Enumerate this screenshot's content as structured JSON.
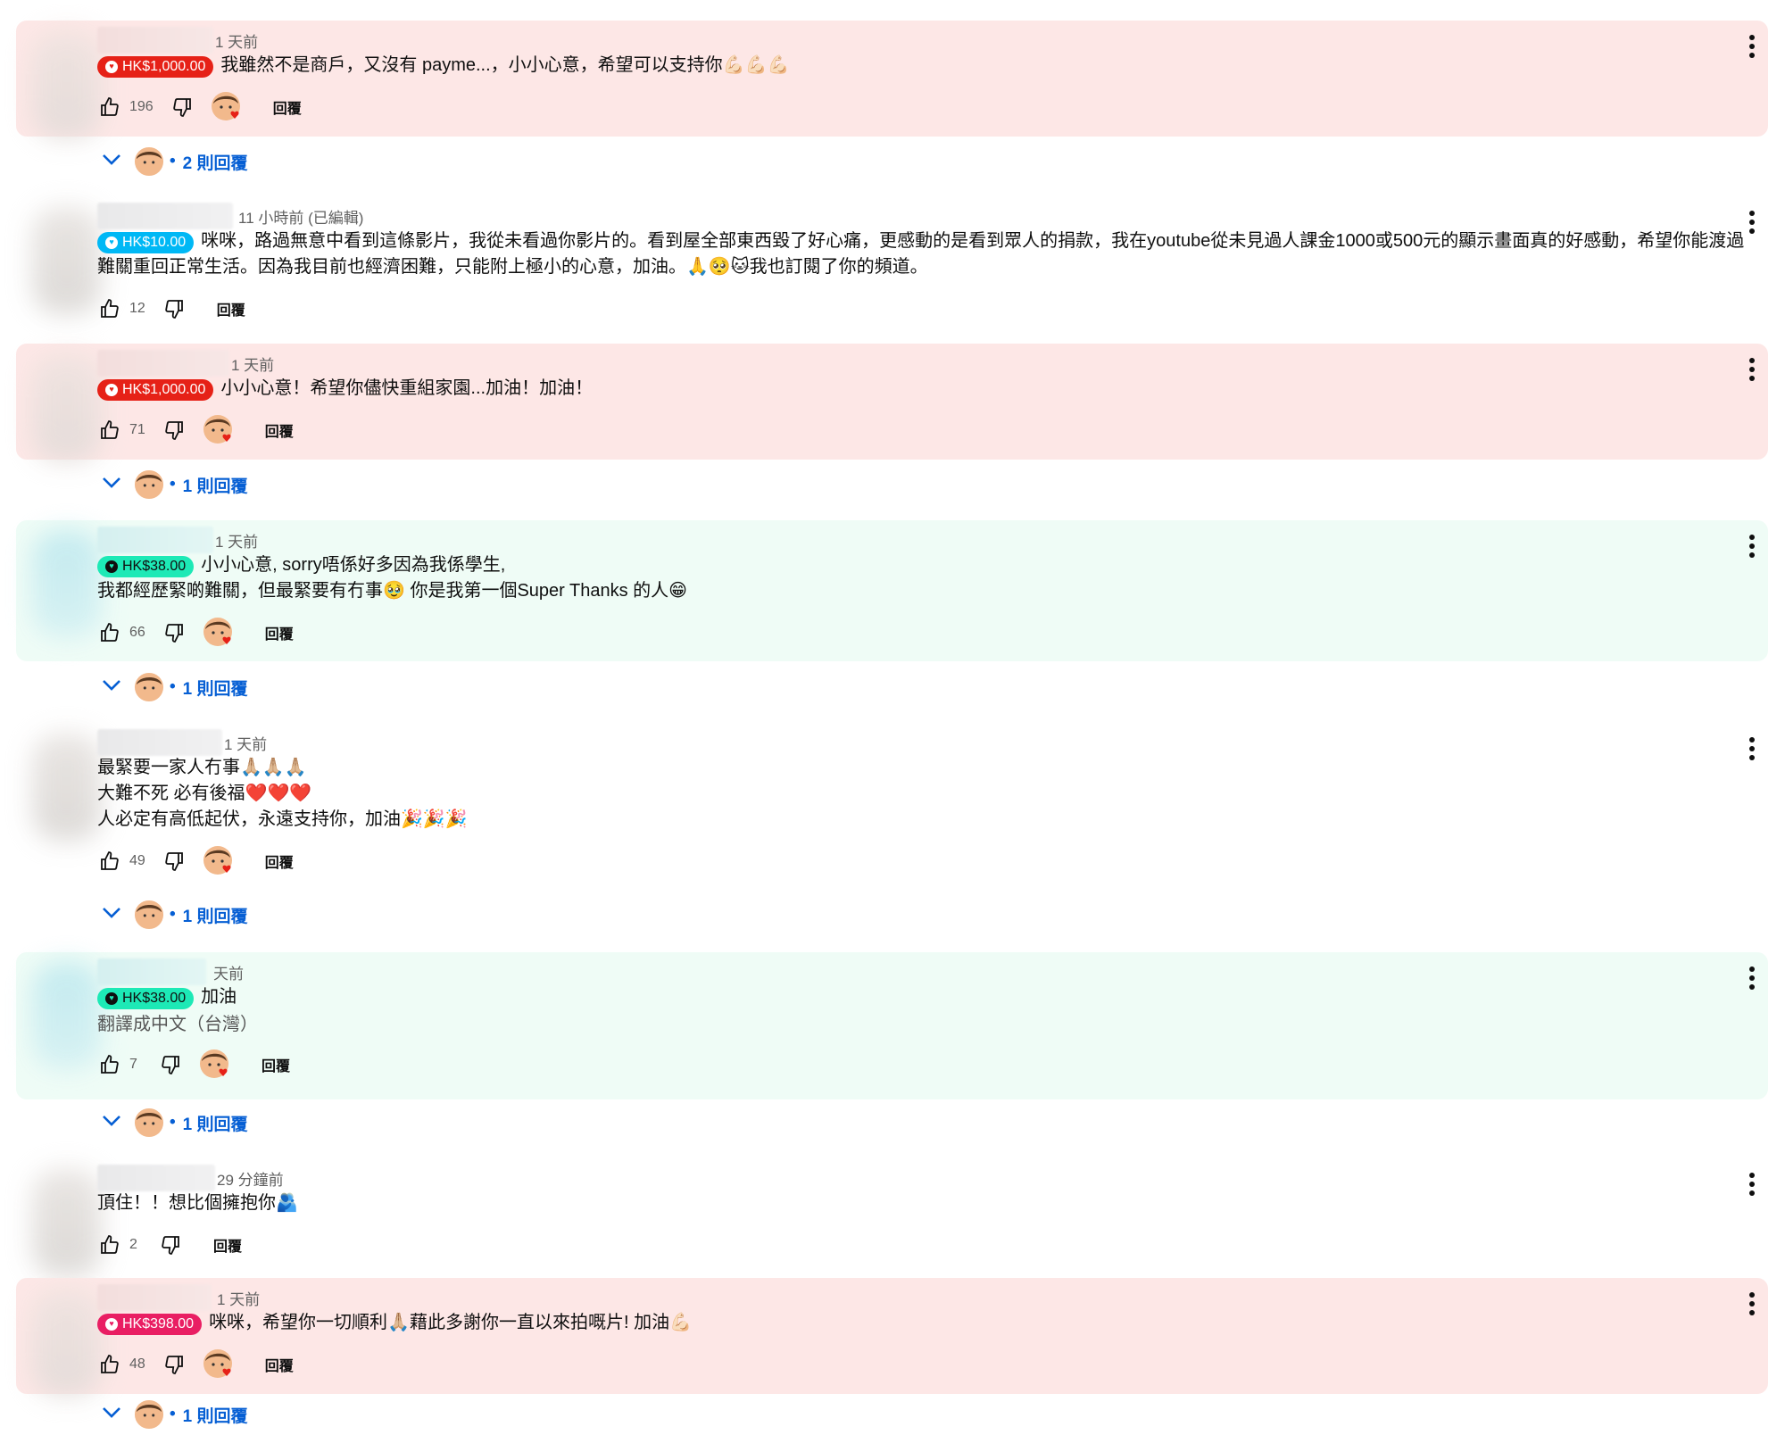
{
  "labels": {
    "reply": "回覆"
  },
  "colors": {
    "red_badge": "#e62117",
    "blue_badge": "#00b8f5",
    "green_badge": "#1de9b6",
    "magenta_badge": "#e91e63",
    "link": "#065fd4"
  },
  "comments": [
    {
      "time": "1 天前",
      "amount": "HK$1,000.00",
      "badge_color": "#e62117",
      "lines": [
        "我雖然不是商戶，又沒有 payme...，小小心意，希望可以支持你💪🏻💪🏻💪🏻"
      ],
      "translation": "",
      "likes": "196",
      "replies": "2 則回覆"
    },
    {
      "time": "11 小時前 (已編輯)",
      "amount": "HK$10.00",
      "badge_color": "#00b8f5",
      "lines": [
        "咪咪，路過無意中看到這條影片，我從未看過你影片的。看到屋全部東西毀了好心痛，更感動的是看到眾人的捐款，我在youtube從未見過人課金1000或500元的顯示畫面真的好感動，希望你能渡過",
        "難關重回正常生活。因為我目前也經濟困難，只能附上極小的心意，加油。🙏🥺🐱我也訂閱了你的頻道。"
      ],
      "translation": "",
      "likes": "12",
      "replies": ""
    },
    {
      "time": "1 天前",
      "amount": "HK$1,000.00",
      "badge_color": "#e62117",
      "lines": [
        "小小心意！希望你儘快重組家園...加油！加油！"
      ],
      "translation": "",
      "likes": "71",
      "replies": "1 則回覆"
    },
    {
      "time": "1 天前",
      "amount": "HK$38.00",
      "badge_color": "#1de9b6",
      "lines": [
        "小小心意, sorry唔係好多因為我係學生,",
        "我都經歷緊啲難關，但最緊要有冇事🥹 你是我第一個Super Thanks 的人😁"
      ],
      "translation": "",
      "likes": "66",
      "replies": "1 則回覆"
    },
    {
      "time": "1 天前",
      "amount": "",
      "badge_color": "",
      "lines": [
        "最緊要一家人冇事🙏🏼🙏🏼🙏🏼",
        "大難不死 必有後福❤️❤️❤️",
        "人必定有高低起伏，永遠支持你，加油🎉🎉🎉"
      ],
      "translation": "",
      "likes": "49",
      "replies": "1 則回覆"
    },
    {
      "time": "天前",
      "amount": "HK$38.00",
      "badge_color": "#1de9b6",
      "lines": [
        "加油"
      ],
      "translation": "翻譯成中文（台灣）",
      "likes": "7",
      "replies": "1 則回覆"
    },
    {
      "time": "29 分鐘前",
      "amount": "",
      "badge_color": "",
      "lines": [
        "頂住！！想比個擁抱你🫂"
      ],
      "translation": "",
      "likes": "2",
      "replies": ""
    },
    {
      "time": "1 天前",
      "amount": "HK$398.00",
      "badge_color": "#e91e63",
      "lines": [
        "咪咪，希望你一切順利🙏🏼藉此多謝你一直以來拍嘅片! 加油💪🏻"
      ],
      "translation": "",
      "likes": "48",
      "replies": "1 則回覆"
    }
  ]
}
